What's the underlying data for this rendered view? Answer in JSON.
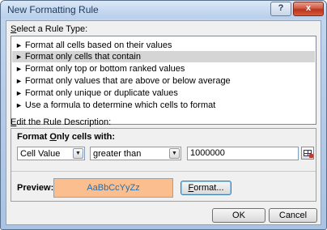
{
  "window": {
    "title": "New Formatting Rule",
    "help_label": "?",
    "close_label": "x"
  },
  "rule_type": {
    "label_underlined": "S",
    "label_rest": "elect a Rule Type:",
    "items": [
      {
        "label": "Format all cells based on their values"
      },
      {
        "label": "Format only cells that contain"
      },
      {
        "label": "Format only top or bottom ranked values"
      },
      {
        "label": "Format only values that are above or below average"
      },
      {
        "label": "Format only unique or duplicate values"
      },
      {
        "label": "Use a formula to determine which cells to format"
      }
    ],
    "selected_index": 1,
    "arrow": "►"
  },
  "description": {
    "label_underlined": "E",
    "label_rest": "dit the Rule Description:",
    "heading_underlined": "O",
    "heading_rest": "nly cells with:",
    "heading_prefix": "Format ",
    "condition_type": "Cell Value",
    "operator": "greater than",
    "value": "1000000",
    "dropdown_glyph": "▼"
  },
  "preview": {
    "label": "Preview:",
    "sample_text": "AaBbCcYyZz",
    "background_color": "#fbbf8f",
    "text_color": "#1f6fb2",
    "format_button_underlined": "F",
    "format_button_rest": "ormat..."
  },
  "buttons": {
    "ok": "OK",
    "cancel": "Cancel"
  }
}
